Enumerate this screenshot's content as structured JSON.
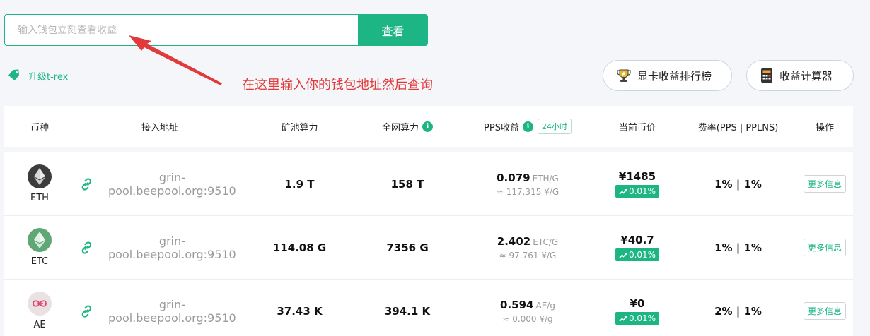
{
  "search": {
    "placeholder": "输入钱包立刻查看收益",
    "button_label": "查看"
  },
  "upgrade": {
    "label": "升级t-rex"
  },
  "annotation": {
    "text": "在这里输入你的钱包地址然后查询"
  },
  "buttons": {
    "gpu_rank": "显卡收益排行榜",
    "calculator": "收益计算器"
  },
  "table": {
    "headers": {
      "coin": "币种",
      "address": "接入地址",
      "pool_hashrate": "矿池算力",
      "network_hashrate": "全网算力",
      "pps": "PPS收益",
      "pps_badge": "24小时",
      "price": "当前币价",
      "fee": "费率(PPS | PPLNS)",
      "action": "操作"
    },
    "rows": [
      {
        "coin": "ETH",
        "address": "grin-pool.beepool.org:9510",
        "pool_hashrate": "1.9 T",
        "network_hashrate": "158 T",
        "pps_value": "0.079",
        "pps_unit": "ETH/G",
        "pps_cny": "≈ 117.315 ¥/G",
        "price": "¥1485",
        "change": "0.01%",
        "fee": "1% | 1%",
        "action": "更多信息"
      },
      {
        "coin": "ETC",
        "address": "grin-pool.beepool.org:9510",
        "pool_hashrate": "114.08 G",
        "network_hashrate": "7356 G",
        "pps_value": "2.402",
        "pps_unit": "ETC/G",
        "pps_cny": "≈ 97.761 ¥/G",
        "price": "¥40.7",
        "change": "0.01%",
        "fee": "1% | 1%",
        "action": "更多信息"
      },
      {
        "coin": "AE",
        "address": "grin-pool.beepool.org:9510",
        "pool_hashrate": "37.43 K",
        "network_hashrate": "394.1 K",
        "pps_value": "0.594",
        "pps_unit": "AE/g",
        "pps_cny": "≈ 0.000 ¥/g",
        "price": "¥0",
        "change": "0.01%",
        "fee": "2% | 1%",
        "action": "更多信息"
      }
    ]
  },
  "colors": {
    "accent": "#1db584",
    "annotation": "#e03a3a",
    "eth_logo": "#3c3c3d",
    "etc_logo": "#5fa876",
    "ae_logo": "#e9e1e4"
  }
}
